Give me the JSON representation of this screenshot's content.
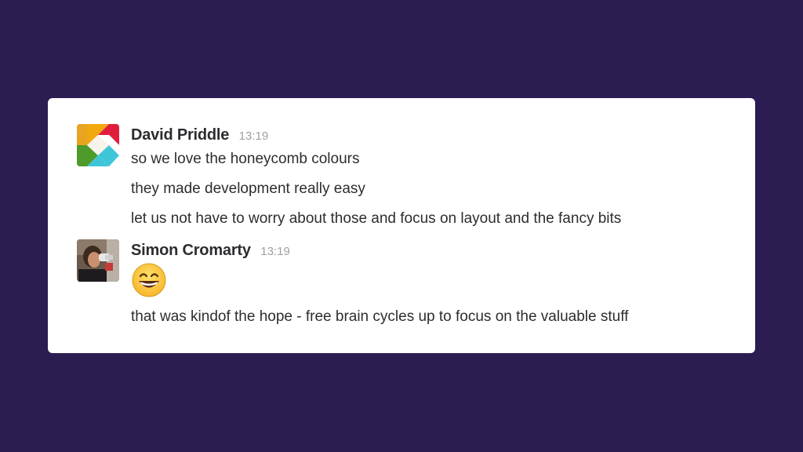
{
  "messages": [
    {
      "author": "David Priddle",
      "time": "13:19",
      "avatar_icon": "slack-logo-avatar",
      "lines": [
        "so we love the honeycomb colours",
        "they made development really easy",
        "let us not have to worry about those and focus on layout and the fancy bits"
      ]
    },
    {
      "author": "Simon Cromarty",
      "time": "13:19",
      "avatar_icon": "user-photo-avatar",
      "emoji": "grinning-face-emoji",
      "lines": [
        "that was kindof the hope - free brain cycles up to focus on the valuable stuff"
      ]
    }
  ],
  "colors": {
    "background": "#2b1d52",
    "card": "#ffffff",
    "text": "#2c2d30",
    "timestamp": "#a0a0a2"
  }
}
